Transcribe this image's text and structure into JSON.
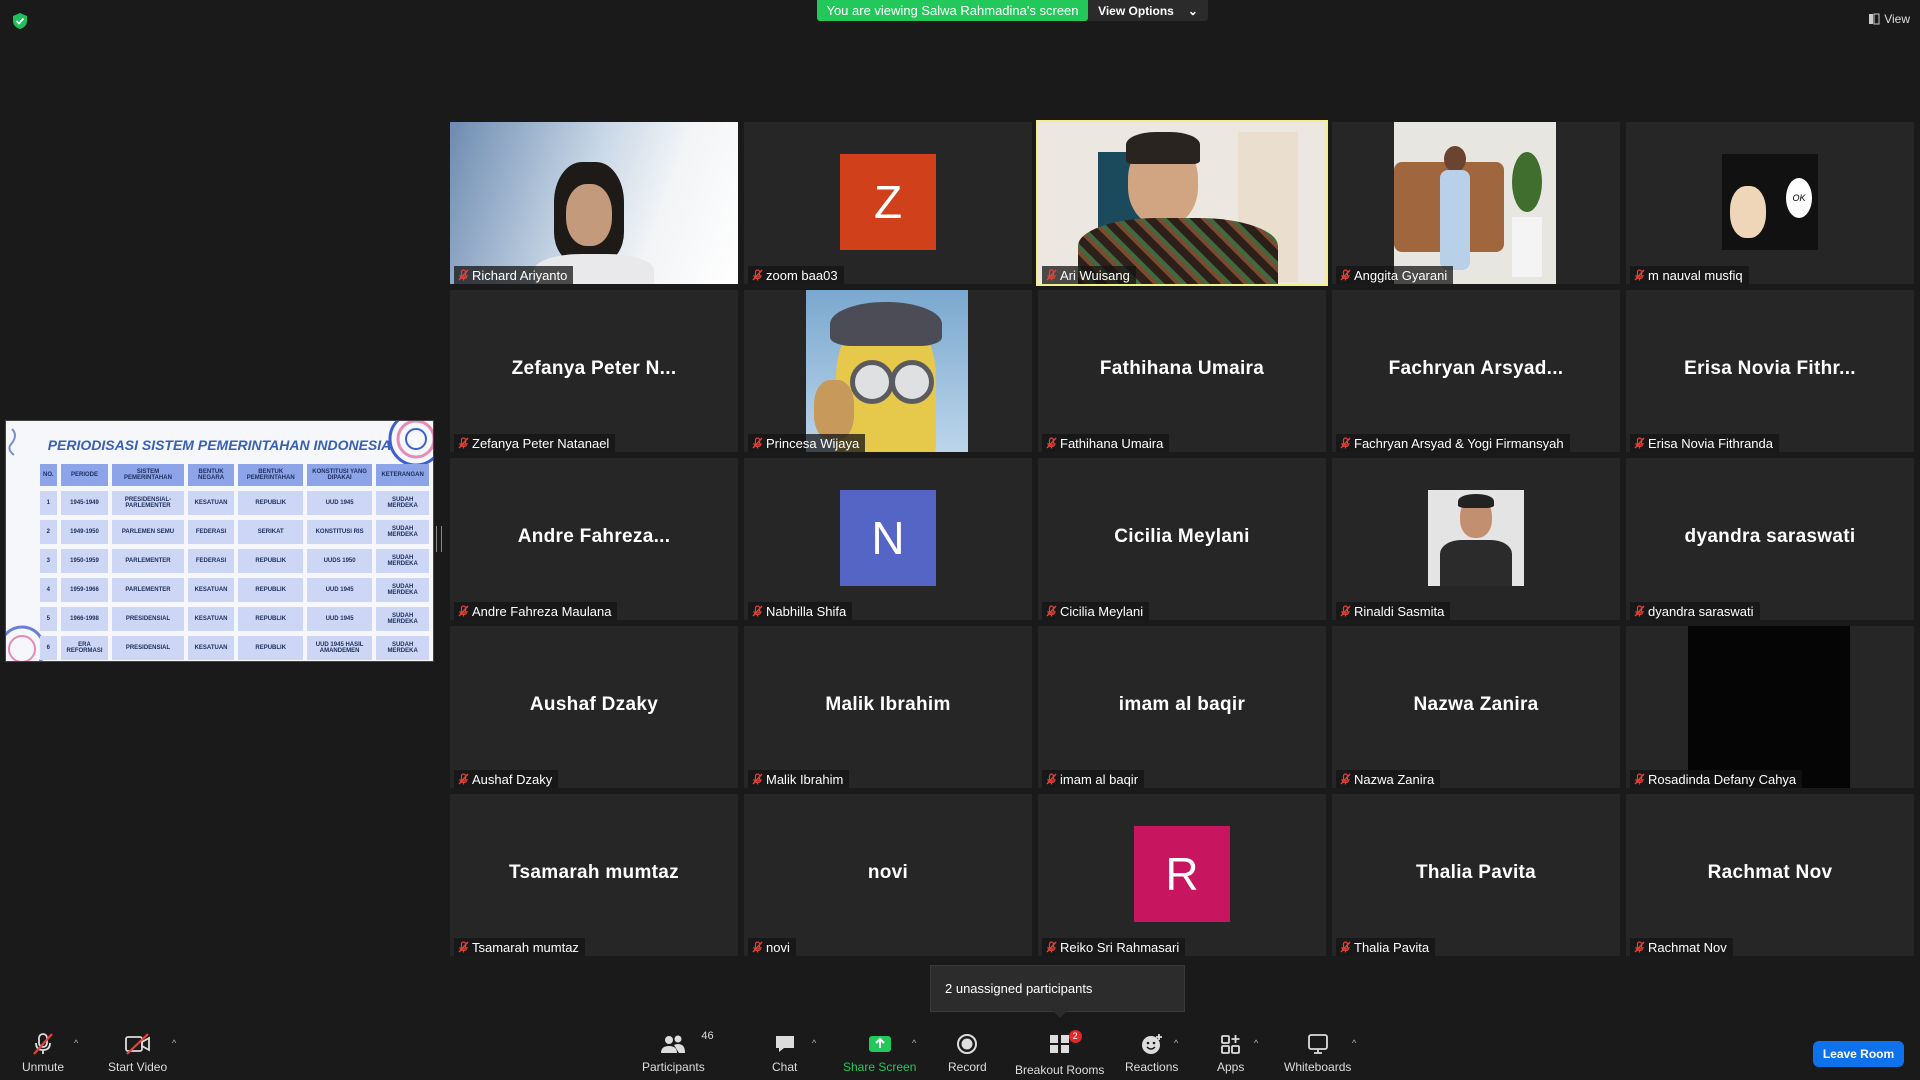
{
  "header": {
    "banner_text": "You are viewing Salwa Rahmadina's screen",
    "view_options_label": "View Options",
    "view_label": "View"
  },
  "shared_screen": {
    "title": "PERIODISASI SISTEM PEMERINTAHAN INDONESIA",
    "columns": [
      "NO.",
      "PERIODE",
      "SISTEM PEMERINTAHAN",
      "BENTUK NEGARA",
      "BENTUK PEMERINTAHAN",
      "KONSTITUSI YANG DIPAKAI",
      "KETERANGAN"
    ],
    "rows": [
      [
        "1",
        "1945-1949",
        "PRESIDENSIAL-PARLEMENTER",
        "KESATUAN",
        "REPUBLIK",
        "UUD 1945",
        "SUDAH MERDEKA"
      ],
      [
        "2",
        "1949-1950",
        "PARLEMEN SEMU",
        "FEDERASI",
        "SERIKAT",
        "KONSTITUSI RIS",
        "SUDAH MERDEKA"
      ],
      [
        "3",
        "1950-1959",
        "PARLEMENTER",
        "FEDERASI",
        "REPUBLIK",
        "UUDS 1950",
        "SUDAH MERDEKA"
      ],
      [
        "4",
        "1959-1966",
        "PARLEMENTER",
        "KESATUAN",
        "REPUBLIK",
        "UUD 1945",
        "SUDAH MERDEKA"
      ],
      [
        "5",
        "1966-1998",
        "PRESIDENSIAL",
        "KESATUAN",
        "REPUBLIK",
        "UUD 1945",
        "SUDAH MERDEKA"
      ],
      [
        "6",
        "ERA REFORMASI",
        "PRESIDENSIAL",
        "KESATUAN",
        "REPUBLIK",
        "UUD 1945 HASIL AMANDEMEN",
        "SUDAH MERDEKA"
      ]
    ]
  },
  "participants": [
    {
      "label": "Richard Ariyanto",
      "kind": "video"
    },
    {
      "label": "zoom baa03",
      "kind": "avatar",
      "letter": "Z",
      "color": "#d0401b"
    },
    {
      "label": "Ari Wuisang",
      "kind": "video",
      "active": true
    },
    {
      "label": "Anggita Gyarani",
      "kind": "video"
    },
    {
      "label": "m nauval musfiq",
      "kind": "video"
    },
    {
      "label": "Zefanya Peter Natanael",
      "kind": "name",
      "big": "Zefanya Peter N..."
    },
    {
      "label": "Princesa Wijaya",
      "kind": "video"
    },
    {
      "label": "Fathihana Umaira",
      "kind": "name",
      "big": "Fathihana Umaira"
    },
    {
      "label": "Fachryan Arsyad & Yogi Firmansyah",
      "kind": "name",
      "big": "Fachryan Arsyad..."
    },
    {
      "label": "Erisa Novia Fithranda",
      "kind": "name",
      "big": "Erisa Novia Fithr..."
    },
    {
      "label": "Andre Fahreza Maulana",
      "kind": "name",
      "big": "Andre Fahreza..."
    },
    {
      "label": "Nabhilla Shifa",
      "kind": "avatar",
      "letter": "N",
      "color": "#5465c6"
    },
    {
      "label": "Cicilia Meylani",
      "kind": "name",
      "big": "Cicilia Meylani"
    },
    {
      "label": "Rinaldi Sasmita",
      "kind": "video"
    },
    {
      "label": "dyandra saraswati",
      "kind": "name",
      "big": "dyandra saraswati"
    },
    {
      "label": "Aushaf Dzaky",
      "kind": "name",
      "big": "Aushaf Dzaky"
    },
    {
      "label": "Malik Ibrahim",
      "kind": "name",
      "big": "Malik Ibrahim"
    },
    {
      "label": "imam al baqir",
      "kind": "name",
      "big": "imam al baqir"
    },
    {
      "label": "Nazwa Zanira",
      "kind": "name",
      "big": "Nazwa Zanira"
    },
    {
      "label": "Rosadinda Defany Cahya",
      "kind": "video"
    },
    {
      "label": "Tsamarah mumtaz",
      "kind": "name",
      "big": "Tsamarah mumtaz"
    },
    {
      "label": "novi",
      "kind": "name",
      "big": "novi"
    },
    {
      "label": "Reiko Sri Rahmasari",
      "kind": "avatar",
      "letter": "R",
      "color": "#c8155f"
    },
    {
      "label": "Thalia Pavita",
      "kind": "name",
      "big": "Thalia Pavita"
    },
    {
      "label": "Rachmat Nov",
      "kind": "name",
      "big": "Rachmat Nov"
    }
  ],
  "tooltip": "2 unassigned participants",
  "toolbar": {
    "unmute": "Unmute",
    "start_video": "Start Video",
    "participants": "Participants",
    "participants_count": "46",
    "chat": "Chat",
    "share_screen": "Share Screen",
    "record": "Record",
    "breakout_rooms": "Breakout Rooms",
    "breakout_badge": "2",
    "reactions": "Reactions",
    "apps": "Apps",
    "whiteboards": "Whiteboards",
    "leave_room": "Leave Room"
  },
  "colors": {
    "banner": "#23c85a",
    "leave": "#0e72ed",
    "active_speaker": "#f2f08a",
    "mic_muted": "#e0443a"
  }
}
